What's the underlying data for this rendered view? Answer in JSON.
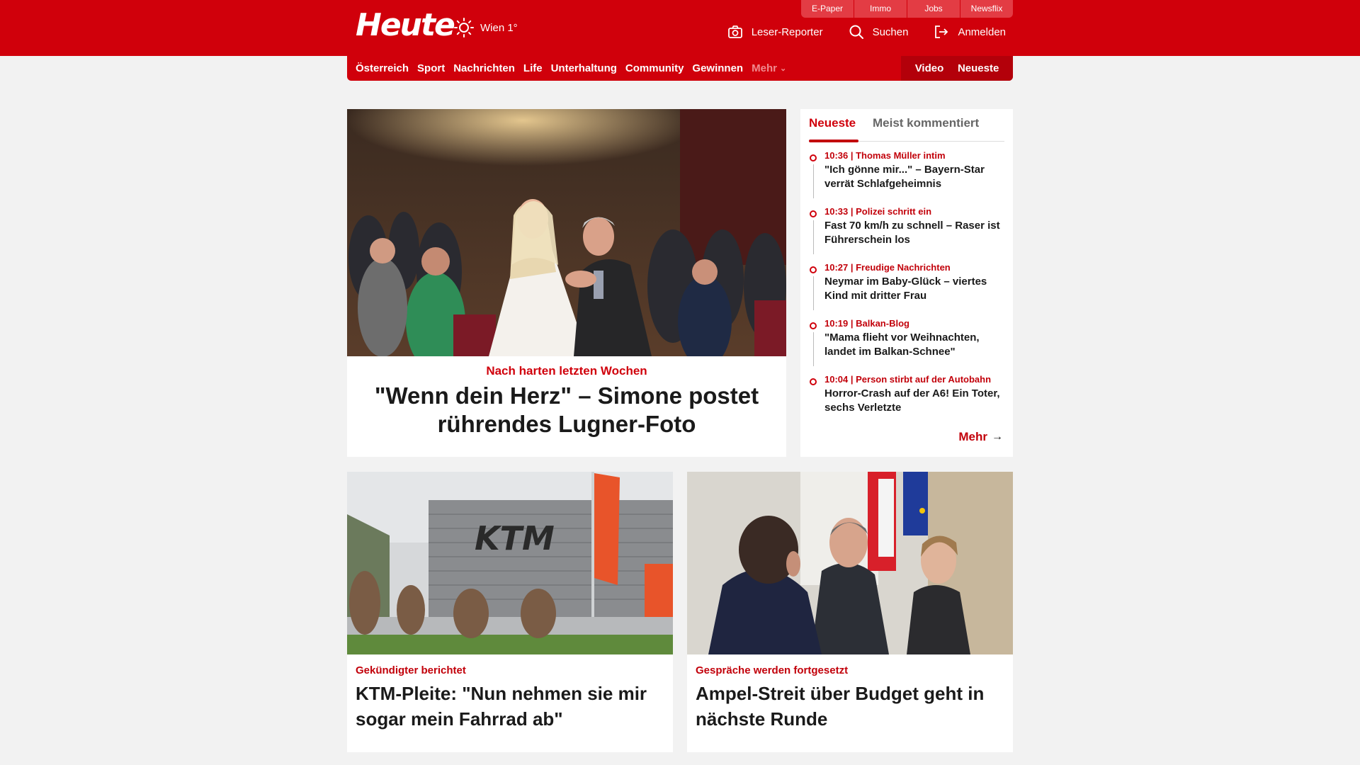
{
  "header": {
    "logo": "Heute",
    "weather": {
      "icon": "sun-icon",
      "text": "Wien 1°"
    },
    "quicklinks": [
      "E-Paper",
      "Immo",
      "Jobs",
      "Newsflix"
    ],
    "actions": [
      {
        "label": "Leser-Reporter",
        "icon": "camera-icon"
      },
      {
        "label": "Suchen",
        "icon": "search-icon"
      },
      {
        "label": "Anmelden",
        "icon": "login-icon"
      }
    ]
  },
  "nav": {
    "items": [
      "Österreich",
      "Sport",
      "Nachrichten",
      "Life",
      "Unterhaltung",
      "Community",
      "Gewinnen"
    ],
    "more": "Mehr",
    "right": [
      "Video",
      "Neueste"
    ]
  },
  "hero": {
    "kicker": "Nach harten letzten Wochen",
    "title": "\"Wenn dein Herz\" – Simone postet rührendes Lugner-Foto"
  },
  "sidebar": {
    "tabs": [
      "Neueste",
      "Meist kommentiert"
    ],
    "items": [
      {
        "meta": "10:36 | Thomas Müller intim",
        "title": "\"Ich gönne mir...\" – Bayern-Star verrät Schlafgeheimnis"
      },
      {
        "meta": "10:33 | Polizei schritt ein",
        "title": "Fast 70 km/h zu schnell – Raser ist Führerschein los"
      },
      {
        "meta": "10:27 | Freudige Nachrichten",
        "title": "Neymar im Baby-Glück – viertes Kind mit dritter Frau"
      },
      {
        "meta": "10:19 | Balkan-Blog",
        "title": "\"Mama flieht vor Weihnachten, landet im Balkan-Schnee\""
      },
      {
        "meta": "10:04 | Person stirbt auf der Autobahn",
        "title": "Horror-Crash auf der A6! Ein Toter, sechs Verletzte"
      }
    ],
    "more": "Mehr"
  },
  "cards": [
    {
      "kicker": "Gekündigter berichtet",
      "title": "KTM-Pleite: \"Nun nehmen sie mir sogar mein Fahrrad ab\"",
      "image_text": "KTM"
    },
    {
      "kicker": "Gespräche werden fortgesetzt",
      "title": "Ampel-Streit über Budget geht in nächste Runde"
    }
  ],
  "colors": {
    "brand": "#d0000b",
    "brand_dark": "#b3000a",
    "link_red": "#c2000a"
  }
}
